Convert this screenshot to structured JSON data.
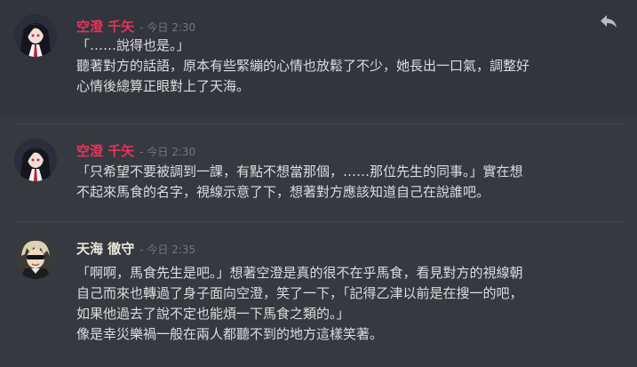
{
  "colors": {
    "background": "#36393f",
    "user_sora": "#e0365d",
    "user_amami": "#e8e6da",
    "text": "#dcddde",
    "timestamp": "#72767d"
  },
  "messages": [
    {
      "username": "空澄 千矢",
      "timestamp": "- 今日 2:30",
      "lines": [
        "「……說得也是。」",
        "聽著對方的話語，原本有些緊繃的心情也放鬆了不少，她長出一口氣，調整好",
        "心情後總算正眼對上了天海。"
      ],
      "actions": {
        "reply_icon": "reply-arrow-icon"
      }
    },
    {
      "username": "空澄 千矢",
      "timestamp": "- 今日 2:30",
      "lines": [
        "「只希望不要被調到一課，有點不想當那個，……那位先生的同事。」實在想",
        "不起來馬食的名字，視線示意了下，想著對方應該知道自己在說誰吧。"
      ]
    },
    {
      "username": "天海 徹守",
      "timestamp": "- 今日 2:35",
      "lines": [
        "「啊啊，馬食先生是吧。」想著空澄是真的很不在乎馬食，看見對方的視線朝",
        "自己而來也轉過了身子面向空澄，笑了一下，「記得乙津以前是在搜一的吧，",
        "如果他過去了說不定也能煩一下馬食之類的。」",
        "像是幸災樂禍一般在兩人都聽不到的地方這樣笑著。"
      ]
    }
  ]
}
